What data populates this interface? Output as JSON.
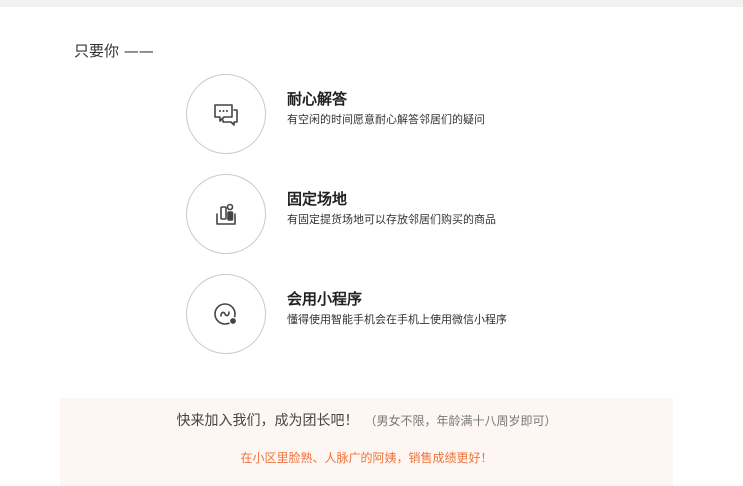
{
  "intro": {
    "label": "只要你 ——"
  },
  "features": [
    {
      "title": "耐心解答",
      "desc": "有空闲的时间愿意耐心解答邻居们的疑问",
      "icon": "chat-bubbles-icon"
    },
    {
      "title": "固定场地",
      "desc": "有固定提货场地可以存放邻居们购买的商品",
      "icon": "location-pickup-icon"
    },
    {
      "title": "会用小程序",
      "desc": "懂得使用智能手机会在手机上使用微信小程序",
      "icon": "mini-program-icon"
    }
  ],
  "cta": {
    "main": "快来加入我们，成为团长吧！",
    "note": "（男女不限，年龄满十八周岁即可）",
    "sub": "在小区里脸熟、人脉广的阿姨，销售成绩更好！"
  },
  "colors": {
    "accent": "#f0733c",
    "cta_background": "#fdf6f3",
    "circle_border": "#c9c9c9",
    "icon": "#444444"
  }
}
